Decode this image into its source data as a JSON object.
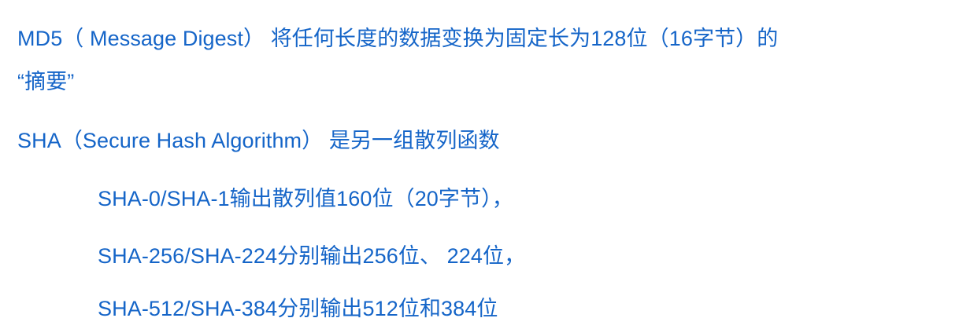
{
  "document": {
    "lines": [
      {
        "text": "MD5（ Message  Digest） 将任何长度的数据变换为固定长为128位（16字节）的"
      },
      {
        "text": "“摘要”"
      },
      {
        "text": "SHA（Secure Hash Algorithm） 是另一组散列函数"
      },
      {
        "text": "SHA-0/SHA-1输出散列值160位（20字节），"
      },
      {
        "text": "SHA-256/SHA-224分别输出256位、 224位，"
      },
      {
        "text": "SHA-512/SHA-384分别输出512位和384位"
      }
    ],
    "text_color": "#1565c8",
    "background_color": "#ffffff"
  }
}
